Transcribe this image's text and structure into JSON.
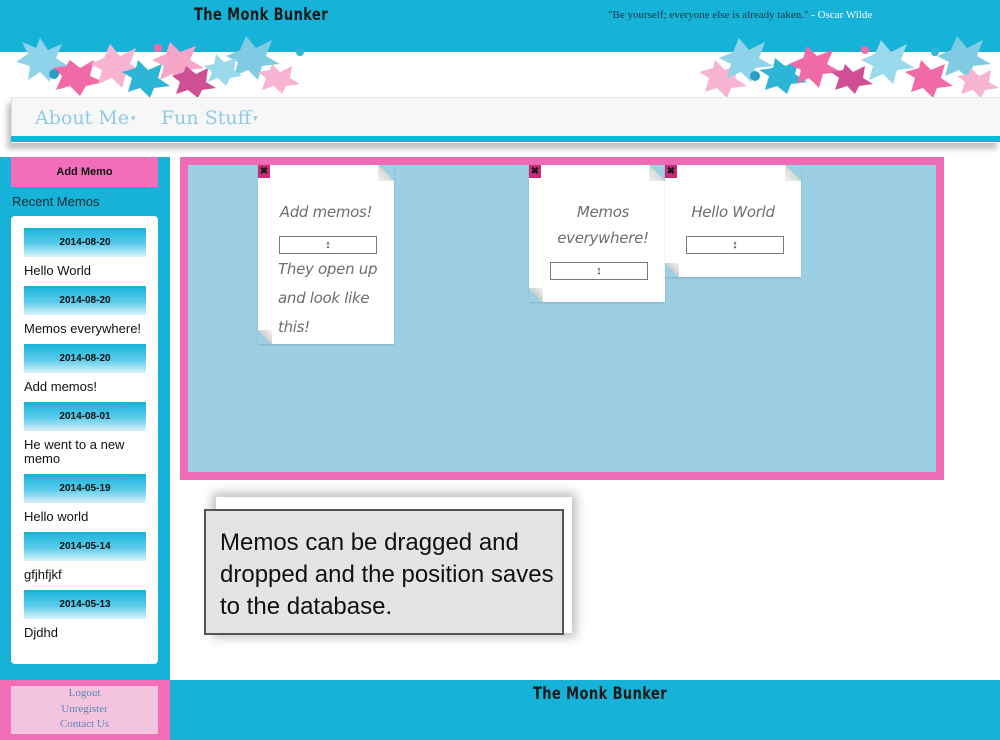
{
  "header": {
    "site_title": "The Monk Bunker",
    "quote": "\"Be yourself; everyone else is already taken.\"",
    "quote_author": " - Oscar Wilde"
  },
  "nav": {
    "items": [
      {
        "label": "About Me",
        "caret": "▾"
      },
      {
        "label": "Fun Stuff",
        "caret": "▾"
      }
    ]
  },
  "sidebar": {
    "add_memo_label": "Add Memo",
    "recent_heading": "Recent Memos",
    "memos": [
      {
        "date": "2014-08-20",
        "title": "Hello World"
      },
      {
        "date": "2014-08-20",
        "title": "Memos everywhere!"
      },
      {
        "date": "2014-08-20",
        "title": "Add memos!"
      },
      {
        "date": "2014-08-01",
        "title": "He went to a new memo"
      },
      {
        "date": "2014-05-19",
        "title": "Hello world"
      },
      {
        "date": "2014-05-14",
        "title": "gfjhfjkf"
      },
      {
        "date": "2014-05-13",
        "title": "Djdhd"
      }
    ]
  },
  "board": {
    "notes": [
      {
        "title": "Add memos!",
        "handle": "↕",
        "close": "✖",
        "body": "They open up and look like this!"
      },
      {
        "title": "Memos everywhere!",
        "handle": "↕",
        "close": "✖"
      },
      {
        "title": "Hello World",
        "handle": "↕",
        "close": "✖"
      }
    ]
  },
  "callout": {
    "text": "Memos can be dragged and dropped and the position saves to the database."
  },
  "footer": {
    "links": [
      "Logout",
      "Unregister",
      "Contact Us"
    ],
    "title": "The Monk Bunker"
  },
  "colors": {
    "cyan": "#17b2d8",
    "pink": "#f26eb9",
    "board_bg": "#9dcfe4"
  }
}
